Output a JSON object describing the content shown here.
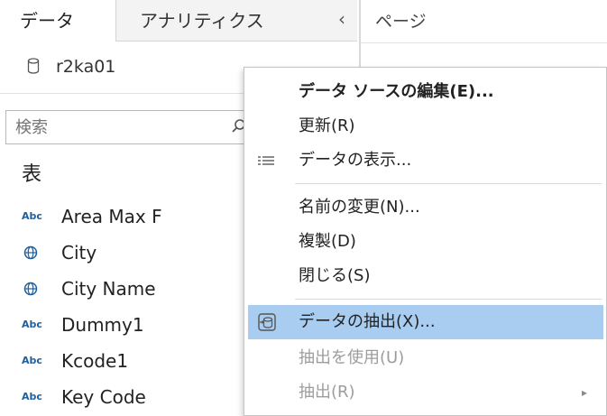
{
  "left_pane": {
    "tabs": [
      {
        "label": "データ"
      },
      {
        "label": "アナリティクス"
      }
    ],
    "collapse_glyph": "‹",
    "datasource": {
      "name": "r2ka01",
      "icon": "database-icon"
    },
    "search": {
      "placeholder": "検索",
      "icon": "search-icon"
    },
    "table_heading": "表",
    "fields": [
      {
        "type_icon": "abc-icon",
        "type_label": "Abc",
        "name": "Area Max F"
      },
      {
        "type_icon": "globe-icon",
        "type_label": "",
        "name": "City"
      },
      {
        "type_icon": "globe-icon",
        "type_label": "",
        "name": "City Name"
      },
      {
        "type_icon": "abc-icon",
        "type_label": "Abc",
        "name": "Dummy1"
      },
      {
        "type_icon": "abc-icon",
        "type_label": "Abc",
        "name": "Kcode1"
      },
      {
        "type_icon": "abc-icon",
        "type_label": "Abc",
        "name": "Key Code"
      }
    ]
  },
  "right_pane": {
    "header": "ページ"
  },
  "context_menu": {
    "items": [
      {
        "label": "データ ソースの編集(E)...",
        "bold": true
      },
      {
        "label": "更新(R)"
      },
      {
        "label": "データの表示...",
        "icon": "data-grid-icon"
      },
      {
        "label": "名前の変更(N)..."
      },
      {
        "label": "複製(D)"
      },
      {
        "label": "閉じる(S)"
      },
      {
        "label": "データの抽出(X)...",
        "icon": "extract-icon",
        "highlighted": true
      },
      {
        "label": "抽出を使用(U)",
        "disabled": true
      },
      {
        "label": "抽出(R)",
        "disabled": true,
        "submenu_glyph": "▸"
      }
    ]
  },
  "colors": {
    "highlight": "#a8cdf0",
    "field_icon": "#1f5f9c",
    "disabled_text": "#9d9d9d"
  }
}
